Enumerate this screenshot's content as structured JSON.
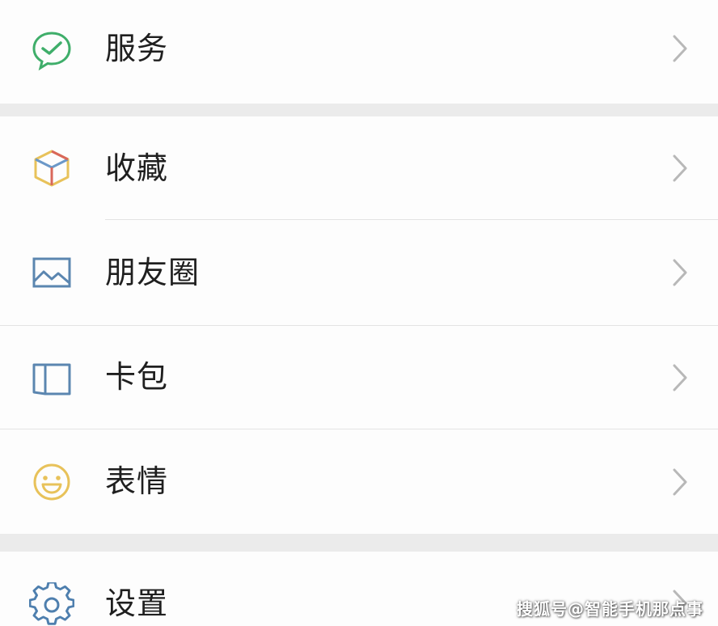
{
  "menu": {
    "items": [
      {
        "label": "服务",
        "icon": "service-check-bubble-icon"
      },
      {
        "label": "收藏",
        "icon": "favorites-cube-icon"
      },
      {
        "label": "朋友圈",
        "icon": "moments-picture-icon"
      },
      {
        "label": "卡包",
        "icon": "card-wallet-icon"
      },
      {
        "label": "表情",
        "icon": "sticker-smiley-icon"
      },
      {
        "label": "设置",
        "icon": "settings-gear-icon"
      }
    ]
  },
  "watermark": {
    "text": "搜狐号@智能手机那点事"
  },
  "colors": {
    "background": "#ebebeb",
    "row": "#fdfdfd",
    "text": "#1f1f1f",
    "chevron": "#b8b8b8",
    "service_icon": "#3fae6a",
    "moments_icon": "#5b86b0",
    "card_icon": "#5b86b0",
    "smiley_icon": "#e8c25a",
    "gear_icon": "#4e7fae"
  }
}
